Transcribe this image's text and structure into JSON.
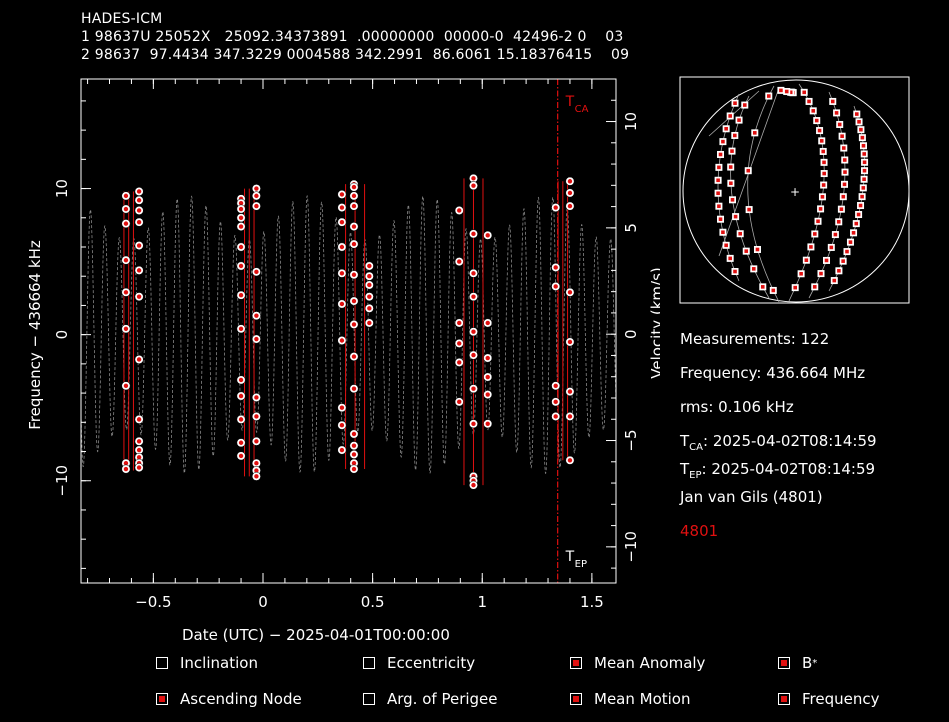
{
  "header": {
    "name": "HADES-ICM",
    "tle1": "1 98637U 25052X   25092.34373891  .00000000  00000-0  42496-2 0    03",
    "tle2": "2 98637  97.4434 347.3229 0004588 342.2991  86.6061 15.18376415    09"
  },
  "info": {
    "measurements": "Measurements: 122",
    "frequency": "Frequency: 436.664 MHz",
    "rms": "rms: 0.106 kHz",
    "tca_label": "T",
    "tca_sub": "CA",
    "tca_value": ": 2025-04-02T08:14:59",
    "tep_label": "T",
    "tep_sub": "EP",
    "tep_value": ": 2025-04-02T08:14:59",
    "observer": "Jan van Gils (4801)",
    "station": "4801"
  },
  "options": [
    {
      "label": "Inclination",
      "checked": false
    },
    {
      "label": "Eccentricity",
      "checked": false
    },
    {
      "label": "Mean Anomaly",
      "checked": true
    },
    {
      "label": "B",
      "sup": "*",
      "checked": true
    },
    {
      "label": "Ascending Node",
      "checked": true
    },
    {
      "label": "Arg. of Perigee",
      "checked": false
    },
    {
      "label": "Mean Motion",
      "checked": true
    },
    {
      "label": "Frequency",
      "checked": true
    }
  ],
  "colors": {
    "accent": "#e01010",
    "model": "#888888",
    "fg": "#ffffff"
  },
  "chart_data": {
    "type": "scatter",
    "xlabel": "Date (UTC) − 2025-04-01T00:00:00",
    "ylabel": "Frequency − 436664 kHz",
    "y2label": "Velocity (km/s)",
    "xlim": [
      -0.83,
      1.61
    ],
    "ylim": [
      -17,
      17.5
    ],
    "y2lim": [
      -11.7,
      12.0
    ],
    "xticks": [
      -0.5,
      0,
      0.5,
      1,
      1.5
    ],
    "xtick_labels": [
      "−0.5",
      "0",
      "0.5",
      "1",
      "1.5"
    ],
    "yticks": [
      -10,
      0,
      10
    ],
    "ytick_labels": [
      "−10",
      "0",
      "10"
    ],
    "y2ticks": [
      -10,
      -5,
      0,
      5,
      10
    ],
    "y2tick_labels": [
      "−10",
      "−5",
      "0",
      "5",
      "10"
    ],
    "tca_x": 1.344,
    "tca_text": "T",
    "tca_sub": "CA",
    "tep_text": "T",
    "tep_sub": "EP",
    "pass_groups": [
      {
        "x0": -0.645,
        "x1": -0.58,
        "top": 9.8,
        "bottom": -9.3
      },
      {
        "x0": -0.095,
        "x1": -0.03,
        "top": 10.0,
        "bottom": -9.7
      },
      {
        "x0": 0.355,
        "x1": 0.485,
        "top": 10.3,
        "bottom": -9.2
      },
      {
        "x0": 0.895,
        "x1": 1.025,
        "top": 10.7,
        "bottom": -10.3
      },
      {
        "x0": 1.335,
        "x1": 1.4,
        "top": 10.5,
        "bottom": -8.6
      }
    ],
    "series": [
      {
        "x": -0.625,
        "y": [
          9.5,
          8.6,
          7.6,
          5.1,
          2.9,
          0.4,
          -3.5,
          -8.8,
          -9.2
        ]
      },
      {
        "x": -0.565,
        "y": [
          9.8,
          9.2,
          8.5,
          7.7,
          6.1,
          4.4,
          2.6,
          -1.7,
          -5.8,
          -7.3,
          -7.9,
          -8.4,
          -8.8,
          -9.1
        ]
      },
      {
        "x": -0.1,
        "y": [
          9.3,
          9.0,
          8.6,
          8.0,
          7.4,
          6.0,
          4.7,
          2.7,
          0.4,
          -3.1,
          -4.2,
          -5.8,
          -7.4,
          -8.3
        ]
      },
      {
        "x": -0.03,
        "y": [
          10.0,
          9.5,
          8.8,
          4.3,
          1.3,
          -0.3,
          -4.3,
          -5.6,
          -7.3,
          -8.8,
          -9.3,
          -9.7
        ]
      },
      {
        "x": 0.36,
        "y": [
          9.6,
          8.7,
          7.7,
          6.0,
          4.2,
          2.1,
          -0.4,
          -5.0,
          -6.2,
          -7.9
        ]
      },
      {
        "x": 0.415,
        "y": [
          10.3,
          10.1,
          9.5,
          8.8,
          7.4,
          6.2,
          4.1,
          2.3,
          0.7,
          -1.5,
          -3.7,
          -6.8,
          -7.6,
          -8.2,
          -8.8,
          -9.2
        ]
      },
      {
        "x": 0.485,
        "y": [
          4.7,
          4.0,
          3.4,
          2.6,
          1.8,
          0.8
        ]
      },
      {
        "x": 0.895,
        "y": [
          8.5,
          5.0,
          0.8,
          -0.6,
          -1.9,
          -4.6
        ]
      },
      {
        "x": 0.96,
        "y": [
          10.7,
          10.2,
          6.9,
          4.2,
          2.6,
          0.2,
          -1.4,
          -3.7,
          -6.1,
          -9.7,
          -10.0,
          -10.3
        ]
      },
      {
        "x": 1.025,
        "y": [
          6.8,
          0.8,
          -1.6,
          -2.9,
          -4.1,
          -6.1
        ]
      },
      {
        "x": 1.335,
        "y": [
          8.7,
          4.6,
          3.3,
          -3.5,
          -4.6,
          -5.6
        ]
      },
      {
        "x": 1.4,
        "y": [
          10.5,
          9.7,
          8.8,
          2.9,
          -0.5,
          -3.9,
          -5.6,
          -8.6
        ]
      }
    ],
    "model_curve": {
      "amplitude": 8.0,
      "period": 0.0659,
      "phase": -0.0125,
      "envelope_amplitude": 1.5,
      "envelope_period": 0.545
    }
  }
}
